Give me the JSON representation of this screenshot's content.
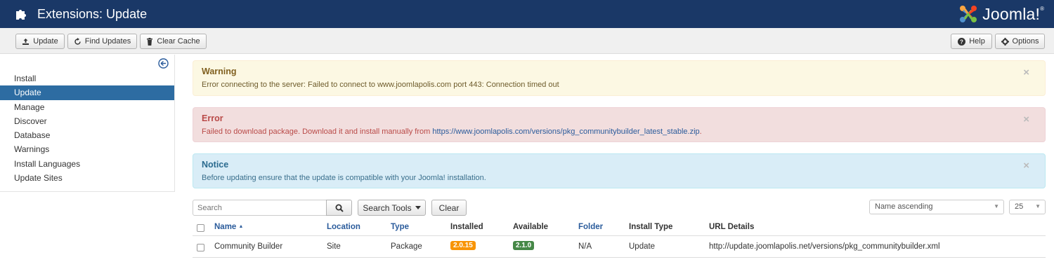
{
  "header": {
    "title": "Extensions: Update",
    "logo_text": "Joomla!",
    "logo_reg": "®"
  },
  "toolbar": {
    "update": "Update",
    "find_updates": "Find Updates",
    "clear_cache": "Clear Cache",
    "help": "Help",
    "options": "Options"
  },
  "sidebar": {
    "items": [
      {
        "label": "Install"
      },
      {
        "label": "Update",
        "active": true
      },
      {
        "label": "Manage"
      },
      {
        "label": "Discover"
      },
      {
        "label": "Database"
      },
      {
        "label": "Warnings"
      },
      {
        "label": "Install Languages"
      },
      {
        "label": "Update Sites"
      }
    ]
  },
  "alerts": {
    "warning": {
      "title": "Warning",
      "message": "Error connecting to the server: Failed to connect to www.joomlapolis.com port 443: Connection timed out",
      "close": "×"
    },
    "error": {
      "title": "Error",
      "message": "Failed to download package. Download it and install manually from ",
      "link": "https://www.joomlapolis.com/versions/pkg_communitybuilder_latest_stable.zip",
      "suffix": ".",
      "close": "×"
    },
    "notice": {
      "title": "Notice",
      "message": "Before updating ensure that the update is compatible with your Joomla! installation.",
      "close": "×"
    }
  },
  "filters": {
    "search_placeholder": "Search",
    "search_tools": "Search Tools",
    "clear": "Clear",
    "ordering": "Name ascending",
    "limit": "25"
  },
  "table": {
    "headers": {
      "name": "Name",
      "sort_indicator": "▲",
      "location": "Location",
      "type": "Type",
      "installed": "Installed",
      "available": "Available",
      "folder": "Folder",
      "install_type": "Install Type",
      "url_details": "URL Details"
    },
    "rows": [
      {
        "name": "Community Builder",
        "location": "Site",
        "type": "Package",
        "installed": "2.0.15",
        "available": "2.1.0",
        "folder": "N/A",
        "install_type": "Update",
        "url": "http://update.joomlapolis.net/versions/pkg_communitybuilder.xml"
      }
    ]
  },
  "colors": {
    "header_bg": "#1a3867",
    "active_nav": "#2d6ca2",
    "link": "#2a5b9b",
    "badge_installed": "#f89406",
    "badge_available": "#468847"
  }
}
